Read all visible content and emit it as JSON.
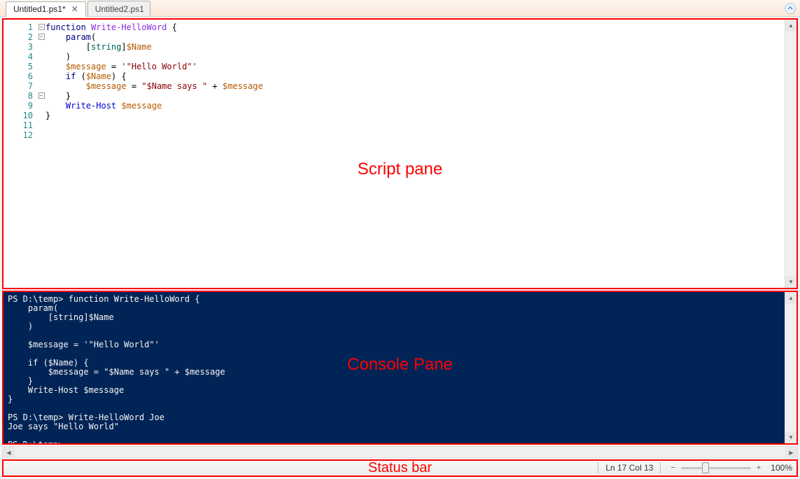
{
  "tabs": [
    {
      "label": "Untitled1.ps1*",
      "active": true,
      "closable": true
    },
    {
      "label": "Untitled2.ps1",
      "active": false,
      "closable": false
    }
  ],
  "script": {
    "annotation": "Script pane",
    "lines": [
      {
        "n": 1,
        "fold": "-",
        "tokens": [
          [
            "kw",
            "function"
          ],
          [
            "",
            ""
          ],
          [
            "fn",
            " Write-HelloWord"
          ],
          [
            "",
            " {"
          ]
        ]
      },
      {
        "n": 2,
        "fold": "-",
        "tokens": [
          [
            "",
            "    "
          ],
          [
            "kw",
            "param"
          ],
          [
            "",
            "("
          ]
        ]
      },
      {
        "n": 3,
        "fold": "",
        "tokens": [
          [
            "",
            "        ["
          ],
          [
            "type",
            "string"
          ],
          [
            "",
            "]"
          ],
          [
            "var",
            "$Name"
          ]
        ]
      },
      {
        "n": 4,
        "fold": "",
        "tokens": [
          [
            "",
            "    )"
          ]
        ]
      },
      {
        "n": 5,
        "fold": "",
        "tokens": [
          [
            "",
            ""
          ]
        ]
      },
      {
        "n": 6,
        "fold": "",
        "tokens": [
          [
            "",
            "    "
          ],
          [
            "var",
            "$message"
          ],
          [
            "",
            " = "
          ],
          [
            "str",
            "'\"Hello World\"'"
          ]
        ]
      },
      {
        "n": 7,
        "fold": "",
        "tokens": [
          [
            "",
            ""
          ]
        ]
      },
      {
        "n": 8,
        "fold": "-",
        "tokens": [
          [
            "",
            "    "
          ],
          [
            "kw",
            "if"
          ],
          [
            "",
            " ("
          ],
          [
            "var",
            "$Name"
          ],
          [
            "",
            ") {"
          ]
        ]
      },
      {
        "n": 9,
        "fold": "",
        "tokens": [
          [
            "",
            "        "
          ],
          [
            "var",
            "$message"
          ],
          [
            "",
            " = "
          ],
          [
            "str",
            "\"$Name says \""
          ],
          [
            "",
            " + "
          ],
          [
            "var",
            "$message"
          ]
        ]
      },
      {
        "n": 10,
        "fold": "",
        "tokens": [
          [
            "",
            "    }"
          ]
        ]
      },
      {
        "n": 11,
        "fold": "",
        "tokens": [
          [
            "",
            "    "
          ],
          [
            "cmd",
            "Write-Host"
          ],
          [
            "",
            " "
          ],
          [
            "var",
            "$message"
          ]
        ]
      },
      {
        "n": 12,
        "fold": "",
        "tokens": [
          [
            "",
            "}"
          ]
        ]
      }
    ]
  },
  "console": {
    "annotation": "Console Pane",
    "text": "PS D:\\temp> function Write-HelloWord {\n    param(\n        [string]$Name\n    )\n\n    $message = '\"Hello World\"'\n\n    if ($Name) {\n        $message = \"$Name says \" + $message\n    }\n    Write-Host $message\n}\n\nPS D:\\temp> Write-HelloWord Joe\nJoe says \"Hello World\"\n\nPS D:\\temp>"
  },
  "status": {
    "annotation": "Status bar",
    "position": "Ln 17  Col 13",
    "zoom": "100%"
  }
}
